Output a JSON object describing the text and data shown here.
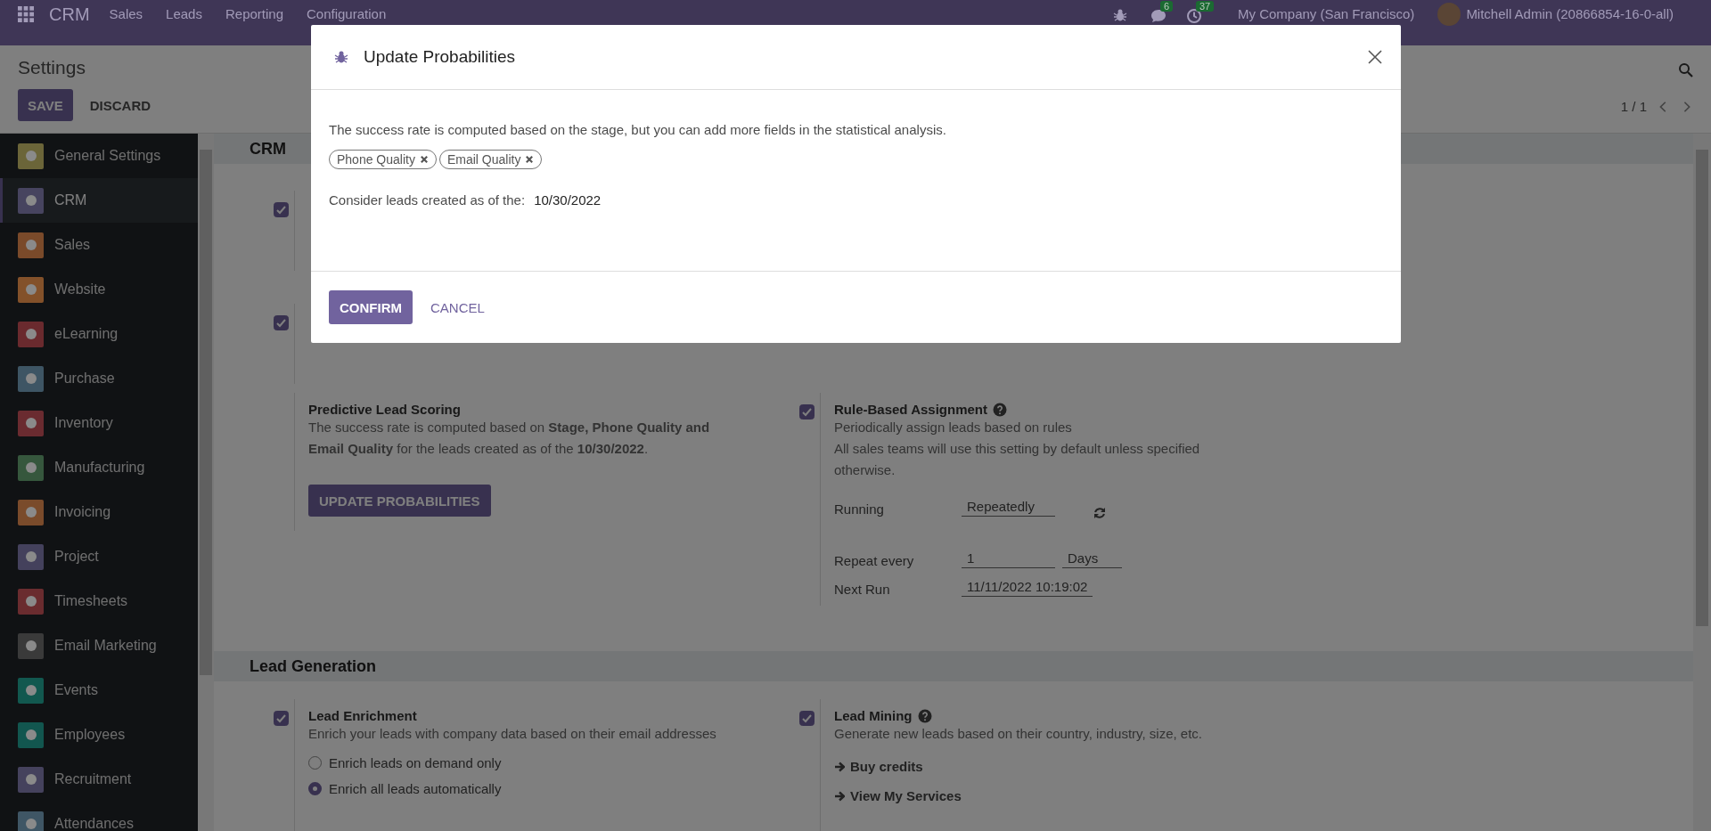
{
  "navbar": {
    "app_name": "CRM",
    "menu": [
      "Sales",
      "Leads",
      "Reporting",
      "Configuration"
    ],
    "messages_count": "6",
    "activities_count": "37",
    "company": "My Company (San Francisco)",
    "user": "Mitchell Admin (20866854-16-0-all)"
  },
  "control_panel": {
    "title": "Settings",
    "buttons": [
      {
        "label": "SAVE",
        "kind": "primary"
      },
      {
        "label": "DISCARD",
        "kind": "link"
      }
    ],
    "pager": "1 / 1"
  },
  "sidebar": {
    "items": [
      {
        "label": "General Settings",
        "color": "#6b6539",
        "selected": false
      },
      {
        "label": "CRM",
        "color": "#47445f",
        "selected": true
      },
      {
        "label": "Sales",
        "color": "#7a4a2a",
        "selected": false
      },
      {
        "label": "Website",
        "color": "#83512a",
        "selected": false
      },
      {
        "label": "eLearning",
        "color": "#6a2a2e",
        "selected": false
      },
      {
        "label": "Purchase",
        "color": "#3e5564",
        "selected": false
      },
      {
        "label": "Inventory",
        "color": "#6a2b30",
        "selected": false
      },
      {
        "label": "Manufacturing",
        "color": "#36573d",
        "selected": false
      },
      {
        "label": "Invoicing",
        "color": "#7a4b2b",
        "selected": false
      },
      {
        "label": "Project",
        "color": "#44415c",
        "selected": false
      },
      {
        "label": "Timesheets",
        "color": "#6a2c2f",
        "selected": false
      },
      {
        "label": "Email Marketing",
        "color": "#3a3a3a",
        "selected": false
      },
      {
        "label": "Events",
        "color": "#12584f",
        "selected": false
      },
      {
        "label": "Employees",
        "color": "#12564f",
        "selected": false
      },
      {
        "label": "Recruitment",
        "color": "#45425d",
        "selected": false
      },
      {
        "label": "Attendances",
        "color": "#3f5665",
        "selected": false
      }
    ]
  },
  "crm_section": {
    "title": "CRM",
    "hidden_rows": [
      {
        "checked": true
      },
      {
        "checked": true
      }
    ],
    "predictive_scoring": {
      "title": "Predictive Lead Scoring",
      "description": "The success rate is computed based on **Stage, Phone Quality and Email Quality** for the leads created as of the **10/30/2022**.",
      "button": "UPDATE PROBABILITIES"
    },
    "rule_assignment": {
      "checked": true,
      "title": "Rule-Based Assignment",
      "description": "Periodically assign leads based on rules",
      "note": "All sales teams will use this setting by default unless specified otherwise.",
      "fields": [
        {
          "label": "Running",
          "value": "Repeatedly"
        },
        {
          "label": "Repeat every",
          "value": "1",
          "unit": "Days"
        },
        {
          "label": "Next Run",
          "value": "11/11/2022 10:19:02"
        }
      ]
    }
  },
  "lead_generation": {
    "title": "Lead Generation",
    "enrichment": {
      "checked": true,
      "title": "Lead Enrichment",
      "description": "Enrich your leads with company data based on their email addresses",
      "options": [
        {
          "label": "Enrich leads on demand only",
          "selected": false
        },
        {
          "label": "Enrich all leads automatically",
          "selected": true
        }
      ]
    },
    "mining": {
      "checked": true,
      "title": "Lead Mining",
      "description": "Generate new leads based on their country, industry, size, etc.",
      "links": [
        "Buy credits",
        "View My Services"
      ]
    }
  },
  "dialog": {
    "title": "Update Probabilities",
    "description": "The success rate is computed based on the stage, but you can add more fields in the statistical analysis.",
    "tags": [
      "Phone Quality",
      "Email Quality"
    ],
    "date_label": "Consider leads created as of the:",
    "date": "10/30/2022",
    "buttons": [
      {
        "label": "CONFIRM",
        "kind": "primary"
      },
      {
        "label": "CANCEL",
        "kind": "link"
      }
    ]
  }
}
